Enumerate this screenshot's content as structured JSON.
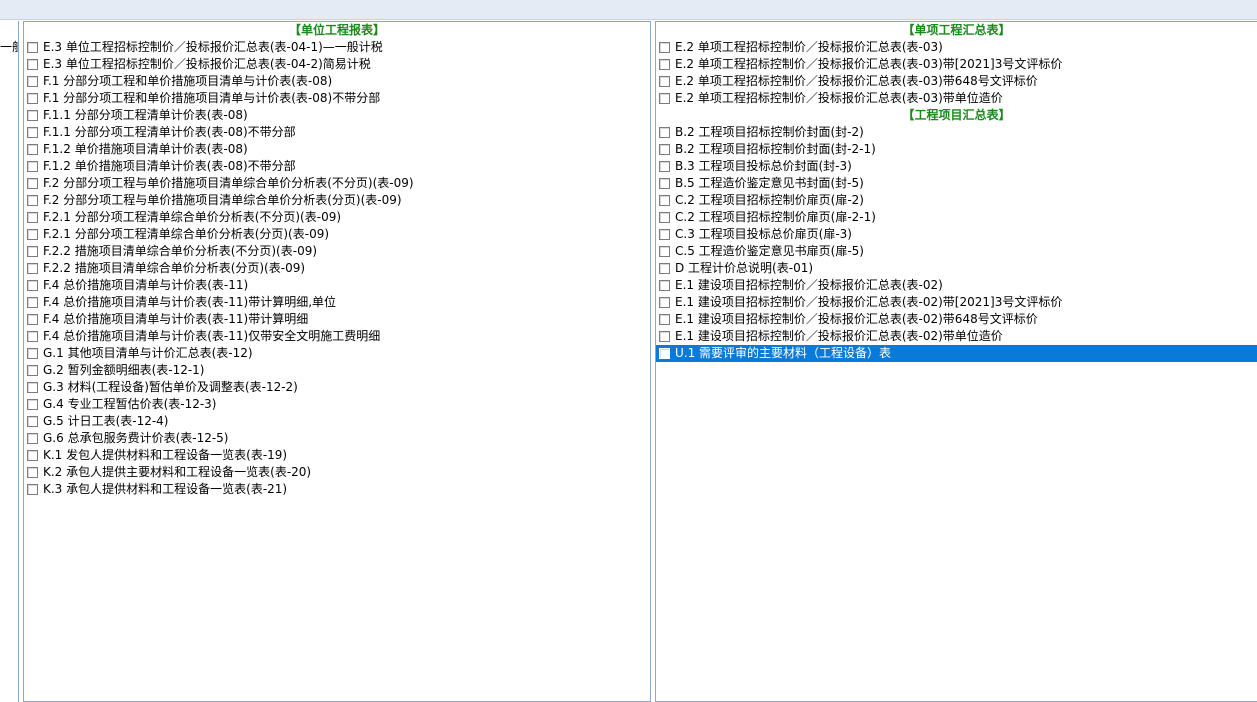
{
  "left_strip": {
    "text": "一般"
  },
  "left_panel": {
    "header": "【单位工程报表】",
    "items": [
      "E.3 单位工程招标控制价／投标报价汇总表(表-04-1)—一般计税",
      "E.3 单位工程招标控制价／投标报价汇总表(表-04-2)简易计税",
      "F.1 分部分项工程和单价措施项目清单与计价表(表-08)",
      "F.1 分部分项工程和单价措施项目清单与计价表(表-08)不带分部",
      "F.1.1 分部分项工程清单计价表(表-08)",
      "F.1.1 分部分项工程清单计价表(表-08)不带分部",
      "F.1.2 单价措施项目清单计价表(表-08)",
      "F.1.2 单价措施项目清单计价表(表-08)不带分部",
      "F.2 分部分项工程与单价措施项目清单综合单价分析表(不分页)(表-09)",
      "F.2 分部分项工程与单价措施项目清单综合单价分析表(分页)(表-09)",
      "F.2.1 分部分项工程清单综合单价分析表(不分页)(表-09)",
      "F.2.1 分部分项工程清单综合单价分析表(分页)(表-09)",
      "F.2.2 措施项目清单综合单价分析表(不分页)(表-09)",
      "F.2.2 措施项目清单综合单价分析表(分页)(表-09)",
      "F.4 总价措施项目清单与计价表(表-11)",
      "F.4 总价措施项目清单与计价表(表-11)带计算明细,单位",
      "F.4 总价措施项目清单与计价表(表-11)带计算明细",
      "F.4 总价措施项目清单与计价表(表-11)仅带安全文明施工费明细",
      "G.1 其他项目清单与计价汇总表(表-12)",
      "G.2 暂列金额明细表(表-12-1)",
      "G.3 材料(工程设备)暂估单价及调整表(表-12-2)",
      "G.4 专业工程暂估价表(表-12-3)",
      "G.5 计日工表(表-12-4)",
      "G.6 总承包服务费计价表(表-12-5)",
      "K.1 发包人提供材料和工程设备一览表(表-19)",
      "K.2 承包人提供主要材料和工程设备一览表(表-20)",
      "K.3 承包人提供材料和工程设备一览表(表-21)"
    ]
  },
  "right_panel": {
    "section1_header": "【单项工程汇总表】",
    "section1_items": [
      "E.2 单项工程招标控制价／投标报价汇总表(表-03)",
      "E.2 单项工程招标控制价／投标报价汇总表(表-03)带[2021]3号文评标价",
      "E.2 单项工程招标控制价／投标报价汇总表(表-03)带648号文评标价",
      "E.2 单项工程招标控制价／投标报价汇总表(表-03)带单位造价"
    ],
    "section2_header": "【工程项目汇总表】",
    "section2_items": [
      "B.2 工程项目招标控制价封面(封-2)",
      "B.2 工程项目招标控制价封面(封-2-1)",
      "B.3 工程项目投标总价封面(封-3)",
      "B.5 工程造价鉴定意见书封面(封-5)",
      "C.2 工程项目招标控制价扉页(扉-2)",
      "C.2 工程项目招标控制价扉页(扉-2-1)",
      "C.3 工程项目投标总价扉页(扉-3)",
      "C.5 工程造价鉴定意见书扉页(扉-5)",
      "D 工程计价总说明(表-01)",
      "E.1 建设项目招标控制价／投标报价汇总表(表-02)",
      "E.1 建设项目招标控制价／投标报价汇总表(表-02)带[2021]3号文评标价",
      "E.1 建设项目招标控制价／投标报价汇总表(表-02)带648号文评标价",
      "E.1 建设项目招标控制价／投标报价汇总表(表-02)带单位造价",
      "U.1 需要评审的主要材料（工程设备）表"
    ],
    "selected_item": "U.1 需要评审的主要材料（工程设备）表"
  },
  "colors": {
    "header_green": "#1a8a1a",
    "selection_blue": "#0a7ad8",
    "panel_border": "#8fa7c4",
    "topbar": "#e4ebf5"
  }
}
